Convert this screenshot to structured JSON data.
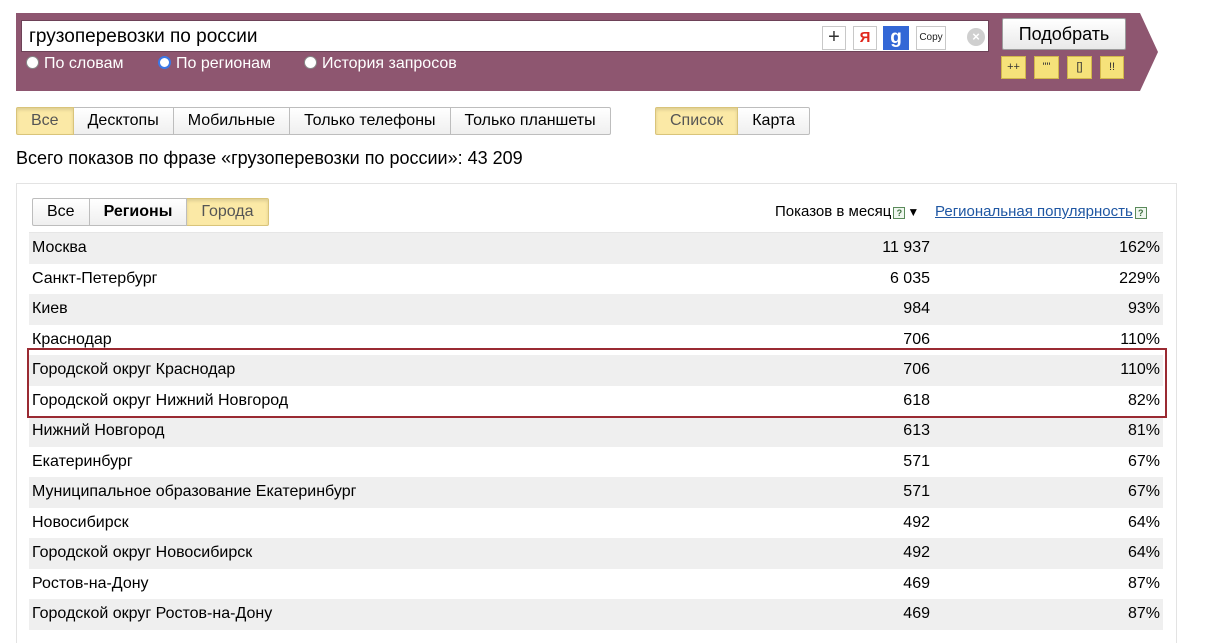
{
  "search": {
    "query": "грузоперевозки по россии",
    "plus_label": "+",
    "yandex_label": "Я",
    "google_label": "g",
    "copy_label": "Copy",
    "clear_label": "×",
    "submit_label": "Подобрать"
  },
  "modes": {
    "options": [
      "По словам",
      "По регионам",
      "История запросов"
    ],
    "selected": "По регионам"
  },
  "operators": [
    "++",
    "\"\"",
    "[]",
    "!!"
  ],
  "devices": {
    "options": [
      "Все",
      "Десктопы",
      "Мобильные",
      "Только телефоны",
      "Только планшеты"
    ],
    "selected": "Все"
  },
  "view": {
    "options": [
      "Список",
      "Карта"
    ],
    "selected": "Список"
  },
  "total_text": "Всего показов по фразе «грузоперевозки по россии»: 43 209",
  "region_tabs": {
    "options": [
      "Все",
      "Регионы",
      "Города"
    ],
    "selected": "Города"
  },
  "columns": {
    "shows": "Показов в месяц",
    "popularity": "Региональная популярность",
    "help": "?",
    "sort": "▼"
  },
  "rows": [
    {
      "name": "Москва",
      "shows": "11 937",
      "pop": "162%"
    },
    {
      "name": "Санкт-Петербург",
      "shows": "6 035",
      "pop": "229%"
    },
    {
      "name": "Киев",
      "shows": "984",
      "pop": "93%"
    },
    {
      "name": "Краснодар",
      "shows": "706",
      "pop": "110%"
    },
    {
      "name": "Городской округ Краснодар",
      "shows": "706",
      "pop": "110%"
    },
    {
      "name": "Городской округ Нижний Новгород",
      "shows": "618",
      "pop": "82%"
    },
    {
      "name": "Нижний Новгород",
      "shows": "613",
      "pop": "81%"
    },
    {
      "name": "Екатеринбург",
      "shows": "571",
      "pop": "67%"
    },
    {
      "name": "Муниципальное образование Екатеринбург",
      "shows": "571",
      "pop": "67%"
    },
    {
      "name": "Новосибирск",
      "shows": "492",
      "pop": "64%"
    },
    {
      "name": "Городской округ Новосибирск",
      "shows": "492",
      "pop": "64%"
    },
    {
      "name": "Ростов-на-Дону",
      "shows": "469",
      "pop": "87%"
    },
    {
      "name": "Городской округ Ростов-на-Дону",
      "shows": "469",
      "pop": "87%"
    }
  ],
  "colors": {
    "banner": "#8e5670",
    "active_button": "#fbe9a6",
    "highlight_border": "#9a2a32",
    "link": "#1f57a3"
  }
}
